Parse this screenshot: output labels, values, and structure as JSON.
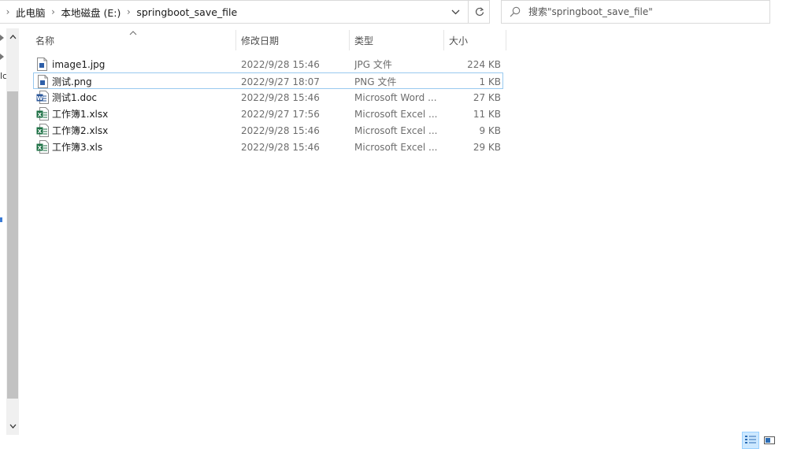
{
  "address": {
    "crumbs": [
      "此电脑",
      "本地磁盘 (E:)",
      "springboot_save_file"
    ]
  },
  "search": {
    "placeholder": "搜索\"springboot_save_file\""
  },
  "columns": {
    "name": "名称",
    "modified": "修改日期",
    "type": "类型",
    "size": "大小"
  },
  "files": [
    {
      "name": "image1.jpg",
      "modified": "2022/9/28 15:46",
      "type": "JPG 文件",
      "size": "224 KB",
      "icon": "image-file-icon"
    },
    {
      "name": "测试.png",
      "modified": "2022/9/27 18:07",
      "type": "PNG 文件",
      "size": "1 KB",
      "icon": "image-file-icon"
    },
    {
      "name": "测试1.doc",
      "modified": "2022/9/28 15:46",
      "type": "Microsoft Word ...",
      "size": "27 KB",
      "icon": "word-file-icon"
    },
    {
      "name": "工作簿1.xlsx",
      "modified": "2022/9/27 17:56",
      "type": "Microsoft Excel ...",
      "size": "11 KB",
      "icon": "excel-file-icon"
    },
    {
      "name": "工作簿2.xlsx",
      "modified": "2022/9/28 15:46",
      "type": "Microsoft Excel ...",
      "size": "9 KB",
      "icon": "excel-file-icon"
    },
    {
      "name": "工作簿3.xls",
      "modified": "2022/9/28 15:46",
      "type": "Microsoft Excel ...",
      "size": "29 KB",
      "icon": "excel-file-icon"
    }
  ],
  "nav_fragment": "lc",
  "colors": {
    "focus_border": "#99c9ef",
    "excel_green": "#1e7145",
    "word_blue": "#2b579a",
    "view_active": "#cce8ff"
  }
}
